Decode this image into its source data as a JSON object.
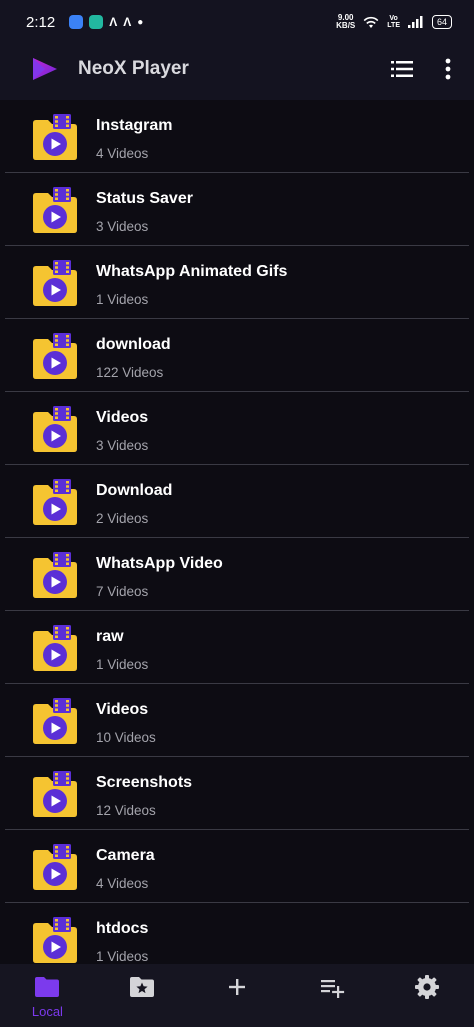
{
  "status": {
    "time": "2:12",
    "speed_value": "9.00",
    "speed_unit": "KB/S",
    "volte_top": "Vo",
    "volte_bottom": "LTE",
    "battery": "64"
  },
  "app": {
    "title": "NeoX Player"
  },
  "folders": [
    {
      "name": "Instagram",
      "count": "4 Videos"
    },
    {
      "name": "Status Saver",
      "count": "3 Videos"
    },
    {
      "name": "WhatsApp Animated Gifs",
      "count": "1 Videos"
    },
    {
      "name": "download",
      "count": "122 Videos"
    },
    {
      "name": "Videos",
      "count": "3 Videos"
    },
    {
      "name": "Download",
      "count": "2 Videos"
    },
    {
      "name": "WhatsApp Video",
      "count": "7 Videos"
    },
    {
      "name": "raw",
      "count": "1 Videos"
    },
    {
      "name": "Videos",
      "count": "10 Videos"
    },
    {
      "name": "Screenshots",
      "count": "12 Videos"
    },
    {
      "name": "Camera",
      "count": "4 Videos"
    },
    {
      "name": "htdocs",
      "count": "1 Videos"
    }
  ],
  "nav": {
    "local_label": "Local",
    "items": [
      "folder-icon",
      "starred-folder-icon",
      "plus-icon",
      "playlist-add-icon",
      "settings-icon"
    ]
  },
  "colors": {
    "background": "#0d0c13",
    "bar": "#141320",
    "accent": "#7c3aed",
    "folder": "#f5c431",
    "play": "#5b2fd6"
  }
}
